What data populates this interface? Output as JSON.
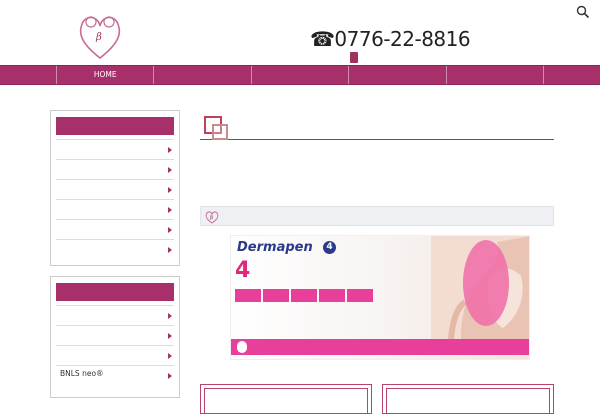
{
  "header": {
    "top_tagline": "",
    "logo_subtitle": "",
    "logo_main": "",
    "logo_clinic": "",
    "contact_note": "",
    "phone": "0776-22-8816",
    "closed_label": "",
    "closed_day": ""
  },
  "nav": {
    "items": [
      {
        "label": "HOME"
      },
      {
        "label": ""
      },
      {
        "label": ""
      },
      {
        "label": ""
      },
      {
        "label": ""
      }
    ]
  },
  "sidebar": {
    "box1": {
      "title": "",
      "items": [
        {
          "label": ""
        },
        {
          "label": ""
        },
        {
          "label": ""
        },
        {
          "label": ""
        },
        {
          "label": ""
        },
        {
          "label": ""
        }
      ]
    },
    "box2": {
      "title": "",
      "items": [
        {
          "label": ""
        },
        {
          "label": ""
        },
        {
          "label": ""
        },
        {
          "label": "BNLS neo®"
        }
      ]
    }
  },
  "main": {
    "page_title": "",
    "lead": "",
    "small_mark": "",
    "subhead": "",
    "banner": {
      "brand": "Dermapen",
      "brand_num": "4",
      "title": "",
      "title_num": "4",
      "tags": [
        "",
        "",
        "",
        "",
        ""
      ],
      "line1": "",
      "line2": "",
      "foot_label": "",
      "foot_text": "",
      "badge_text": ""
    },
    "cards": [
      {
        "label": ""
      },
      {
        "label": ""
      }
    ]
  },
  "colors": {
    "brand": "#a8306a",
    "banner_pink": "#e8409a",
    "banner_navy": "#1f3e8f"
  }
}
